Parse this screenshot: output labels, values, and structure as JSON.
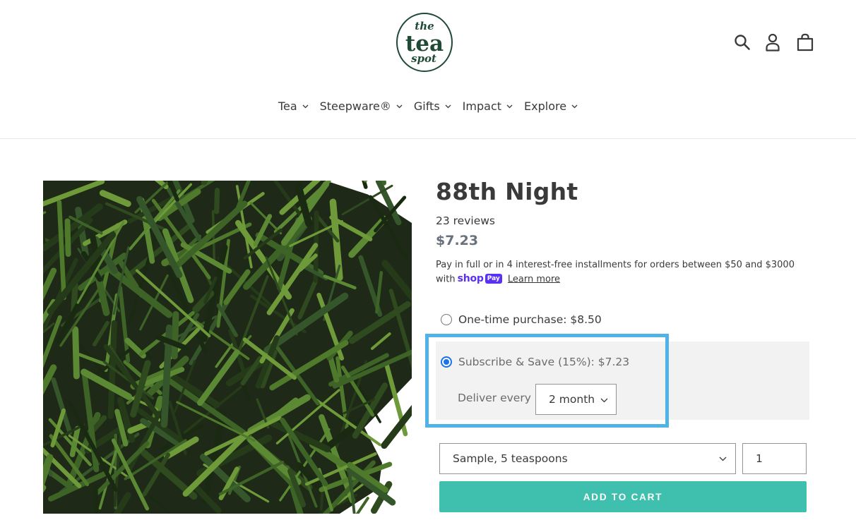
{
  "brand": {
    "logo_alt": "the tea spot",
    "logo_line1": "the",
    "logo_line2": "tea",
    "logo_line3": "spot",
    "logo_color": "#1f4a36"
  },
  "header": {
    "icons": [
      "search-icon",
      "account-icon",
      "cart-icon"
    ]
  },
  "nav": {
    "items": [
      {
        "label": "Tea"
      },
      {
        "label": "Steepware®"
      },
      {
        "label": "Gifts"
      },
      {
        "label": "Impact"
      },
      {
        "label": "Explore"
      }
    ]
  },
  "product": {
    "title": "88th Night",
    "reviews": "23 reviews",
    "price": "$7.23",
    "installments_text": "Pay in full or in 4 interest-free installments for orders between $50 and $3000 with",
    "shop_pay_word": "shop",
    "shop_pay_badge": "Pay",
    "learn_more": "Learn more",
    "purchase_options": {
      "one_time": "One-time purchase: $8.50",
      "subscribe": "Subscribe & Save (15%): $7.23",
      "selected": "subscribe"
    },
    "deliver_every_label": "Deliver every",
    "deliver_interval": "2 month",
    "variant": "Sample, 5 teaspoons",
    "quantity": "1",
    "add_to_cart": "ADD TO CART"
  },
  "colors": {
    "accent_button": "#3fbfad",
    "highlight_border": "#4fb3e8",
    "radio_selected": "#1a73e8",
    "price": "#69727b",
    "shop_pay": "#5a31f4"
  }
}
